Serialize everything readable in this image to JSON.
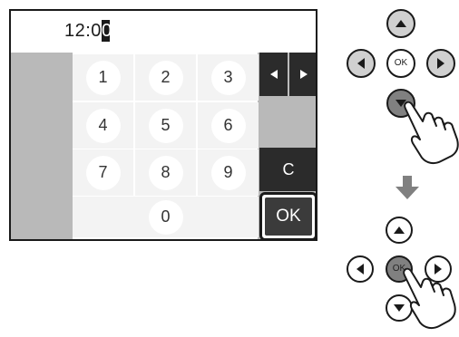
{
  "screen": {
    "time": {
      "prefix": "12:0",
      "cursor_char": "0"
    },
    "keypad": {
      "keys": [
        "1",
        "2",
        "3",
        "4",
        "5",
        "6",
        "7",
        "8",
        "9",
        "0"
      ]
    },
    "side_buttons": {
      "clear_label": "C",
      "ok_label": "OK",
      "left_arrow_icon": "triangle-left-icon",
      "right_arrow_icon": "triangle-right-icon"
    }
  },
  "remote_top": {
    "ok_label": "OK",
    "pressed_button": "down"
  },
  "remote_bottom": {
    "ok_label": "OK",
    "pressed_button": "ok"
  },
  "transition_icon": "arrow-down-icon",
  "colors": {
    "key_bg": "#f3f3f3",
    "dark_button": "#2b2b2b",
    "screen_grey": "#b9b9b9",
    "pressed_grey": "#808080",
    "pad_grey": "#d0d0d0"
  }
}
